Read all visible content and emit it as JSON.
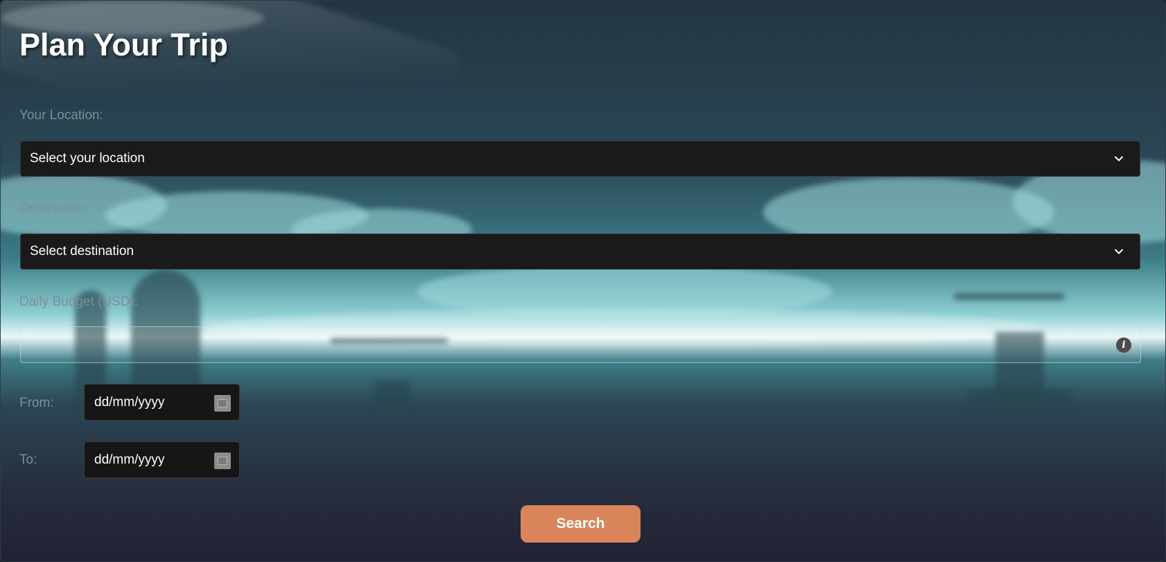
{
  "page": {
    "title": "Plan Your Trip"
  },
  "form": {
    "location": {
      "label": "Your Location:",
      "selected": "Select your location"
    },
    "destination": {
      "label": "Destination:",
      "selected": "Select destination"
    },
    "budget": {
      "label": "Daily Budget (USD):",
      "value": "",
      "info_icon": "i"
    },
    "from": {
      "label": "From:",
      "placeholder": "dd/mm/yyyy"
    },
    "to": {
      "label": "To:",
      "placeholder": "dd/mm/yyyy"
    },
    "search_label": "Search"
  },
  "colors": {
    "accent": "#d9845a",
    "field_bg": "#1a1a1b",
    "label": "#7d8f99"
  },
  "icons": {
    "select_arrow": "chevron-down-icon",
    "info": "info-icon",
    "calendar": "calendar-icon"
  }
}
